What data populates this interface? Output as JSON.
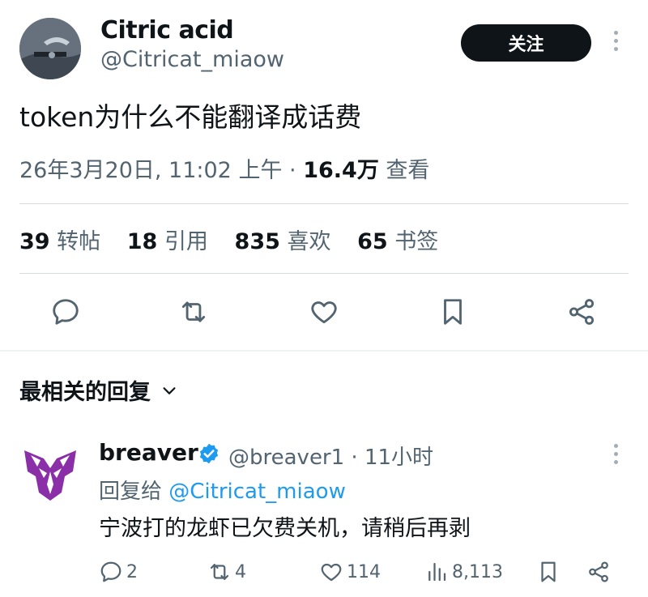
{
  "author": {
    "name": "Citric acid",
    "handle": "@Citricat_miaow",
    "follow_label": "关注"
  },
  "tweet": {
    "text": "token为什么不能翻译成话费",
    "timestamp": "26年3月20日, 11:02 上午 · ",
    "views_count": "16.4万",
    "views_label": " 查看"
  },
  "stats": [
    {
      "count": "39",
      "label": "转帖"
    },
    {
      "count": "18",
      "label": "引用"
    },
    {
      "count": "835",
      "label": "喜欢"
    },
    {
      "count": "65",
      "label": "书签"
    }
  ],
  "actions": [
    "reply-icon",
    "retweet-icon",
    "like-icon",
    "bookmark-icon",
    "share-icon"
  ],
  "replies_header": {
    "label": "最相关的回复"
  },
  "reply": {
    "name": "breaver",
    "handle_time": "@breaver1 · 11小时",
    "reply_to_prefix": "回复给 ",
    "reply_to_handle": "@Citricat_miaow",
    "text": "宁波打的龙虾已欠费关机，请稍后再剥",
    "counts": {
      "replies": "2",
      "retweets": "4",
      "likes": "114",
      "views": "8,113"
    }
  },
  "colors": {
    "text": "#0f1419",
    "secondary": "#536471",
    "link": "#1d9bf0",
    "verified": "#1d9bf0",
    "decepticon": "#8b2fa8"
  }
}
